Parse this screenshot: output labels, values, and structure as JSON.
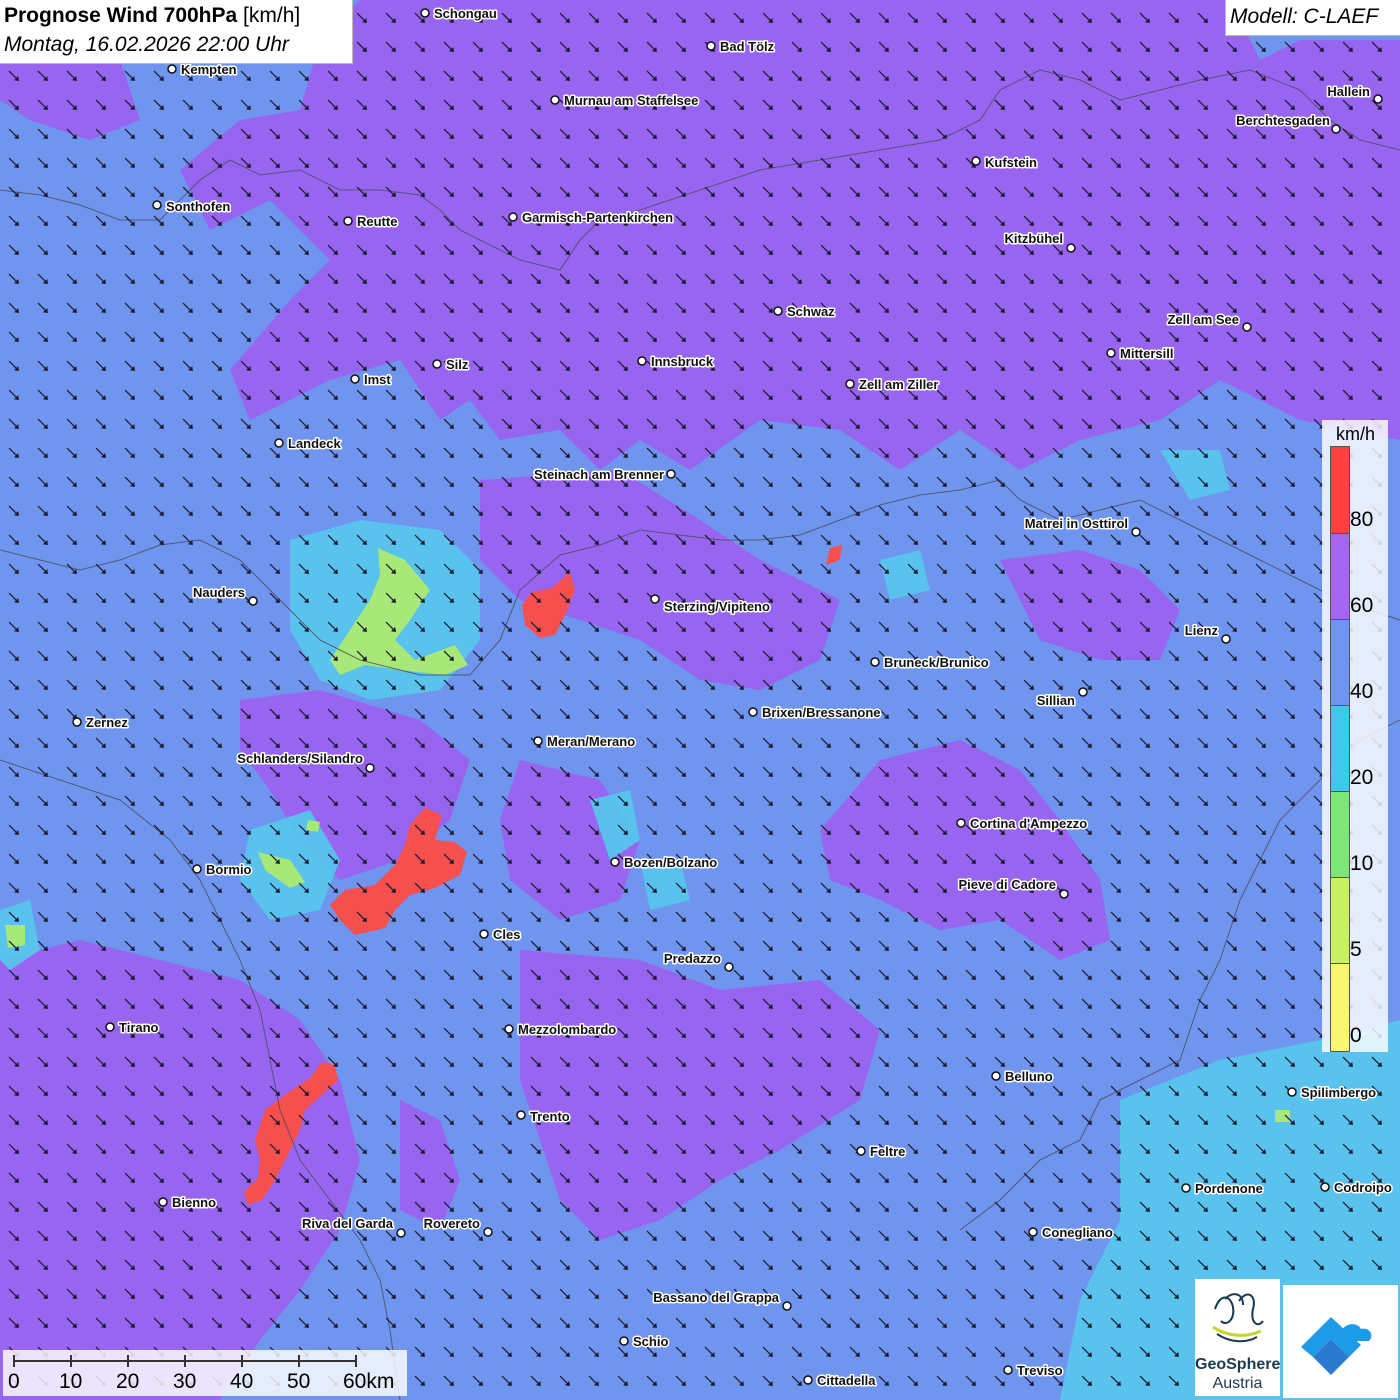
{
  "header": {
    "title_bold": "Prognose Wind 700hPa",
    "title_unit": "[km/h]",
    "datetime": "Montag, 16.02.2026 22:00 Uhr"
  },
  "model": {
    "label": "Modell: C-LAEF"
  },
  "legend": {
    "unit": "km/h",
    "labels": [
      "80",
      "60",
      "40",
      "20",
      "10",
      "5",
      "0"
    ],
    "colors": [
      "#ff4040",
      "#a566f2",
      "#6f95ef",
      "#3ec8ee",
      "#7ee678",
      "#c8f060",
      "#f8f870"
    ]
  },
  "scalebar": {
    "labels": [
      "0",
      "10",
      "20",
      "30",
      "40",
      "50",
      "60km"
    ]
  },
  "colors": {
    "base": "#6f95ef",
    "strong": "#9a62f0",
    "cyan": "#57c4ec",
    "green": "#a8e878",
    "red": "#f5504e",
    "arrow": "#1a1a2e"
  },
  "wind": {
    "direction": "north-west",
    "arrow_icon": "wind-arrow-icon"
  },
  "cities": [
    {
      "name": "Schongau"
    },
    {
      "name": "Kempten"
    },
    {
      "name": "Bad Tölz"
    },
    {
      "name": "Murnau am Staffelsee"
    },
    {
      "name": "Hallein"
    },
    {
      "name": "Berchtesgaden"
    },
    {
      "name": "Kufstein"
    },
    {
      "name": "Sonthofen"
    },
    {
      "name": "Reutte"
    },
    {
      "name": "Garmisch-Partenkirchen"
    },
    {
      "name": "Kitzbühel"
    },
    {
      "name": "Schwaz"
    },
    {
      "name": "Zell am See"
    },
    {
      "name": "Mittersill"
    },
    {
      "name": "Innsbruck"
    },
    {
      "name": "Silz"
    },
    {
      "name": "Imst"
    },
    {
      "name": "Zell am Ziller"
    },
    {
      "name": "Landeck"
    },
    {
      "name": "Steinach am Brenner"
    },
    {
      "name": "Matrei in Osttirol"
    },
    {
      "name": "Nauders"
    },
    {
      "name": "Sterzing/Vipiteno"
    },
    {
      "name": "Lienz"
    },
    {
      "name": "Bruneck/Brunico"
    },
    {
      "name": "Sillian"
    },
    {
      "name": "Zernez"
    },
    {
      "name": "Brixen/Bressanone"
    },
    {
      "name": "Meran/Merano"
    },
    {
      "name": "Schlanders/Silandro"
    },
    {
      "name": "Cortina d'Ampezzo"
    },
    {
      "name": "Bozen/Bolzano"
    },
    {
      "name": "Bormio"
    },
    {
      "name": "Pieve di Cadore"
    },
    {
      "name": "Cles"
    },
    {
      "name": "Predazzo"
    },
    {
      "name": "Tirano"
    },
    {
      "name": "Mezzolombardo"
    },
    {
      "name": "Belluno"
    },
    {
      "name": "Spilimbergo"
    },
    {
      "name": "Trento"
    },
    {
      "name": "Feltre"
    },
    {
      "name": "Pordenone"
    },
    {
      "name": "Codroipo"
    },
    {
      "name": "Bienno"
    },
    {
      "name": "Riva del Garda"
    },
    {
      "name": "Rovereto"
    },
    {
      "name": "Conegliano"
    },
    {
      "name": "Bassano del Grappa"
    },
    {
      "name": "Schio"
    },
    {
      "name": "Treviso"
    },
    {
      "name": "Cittadella"
    }
  ],
  "logos": {
    "geosphere_line1": "GeoSphere",
    "geosphere_line2": "Austria"
  }
}
